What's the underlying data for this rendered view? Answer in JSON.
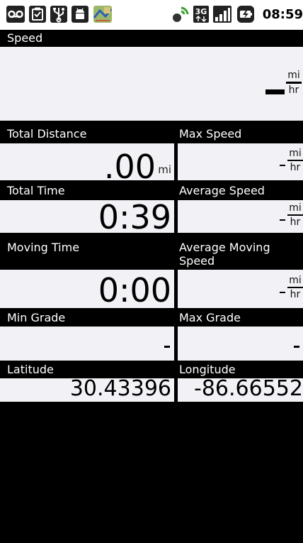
{
  "status_bar": {
    "time": "08:59",
    "icons": [
      "voicemail-icon",
      "clipboard-icon",
      "usb-icon",
      "android-debug-icon",
      "map-app-icon",
      "gps-signal-icon",
      "3g-data-icon",
      "signal-bars-icon",
      "battery-charging-icon"
    ]
  },
  "speed": {
    "label": "Speed",
    "value": "-",
    "unit_top": "mi",
    "unit_bottom": "hr"
  },
  "total_distance": {
    "label": "Total Distance",
    "value": ".00",
    "unit": "mi"
  },
  "max_speed": {
    "label": "Max Speed",
    "value": "-",
    "unit_top": "mi",
    "unit_bottom": "hr"
  },
  "total_time": {
    "label": "Total Time",
    "value": "0:39"
  },
  "average_speed": {
    "label": "Average Speed",
    "value": "-",
    "unit_top": "mi",
    "unit_bottom": "hr"
  },
  "moving_time": {
    "label": "Moving Time",
    "value": "0:00"
  },
  "average_moving_speed": {
    "label_line1": "Average Moving",
    "label_line2": "Speed",
    "value": "-",
    "unit_top": "mi",
    "unit_bottom": "hr"
  },
  "min_grade": {
    "label": "Min Grade",
    "value": "-"
  },
  "max_grade": {
    "label": "Max Grade",
    "value": "-"
  },
  "latitude": {
    "label": "Latitude",
    "value": "30.43396"
  },
  "longitude": {
    "label": "Longitude",
    "value": "-86.66552"
  }
}
